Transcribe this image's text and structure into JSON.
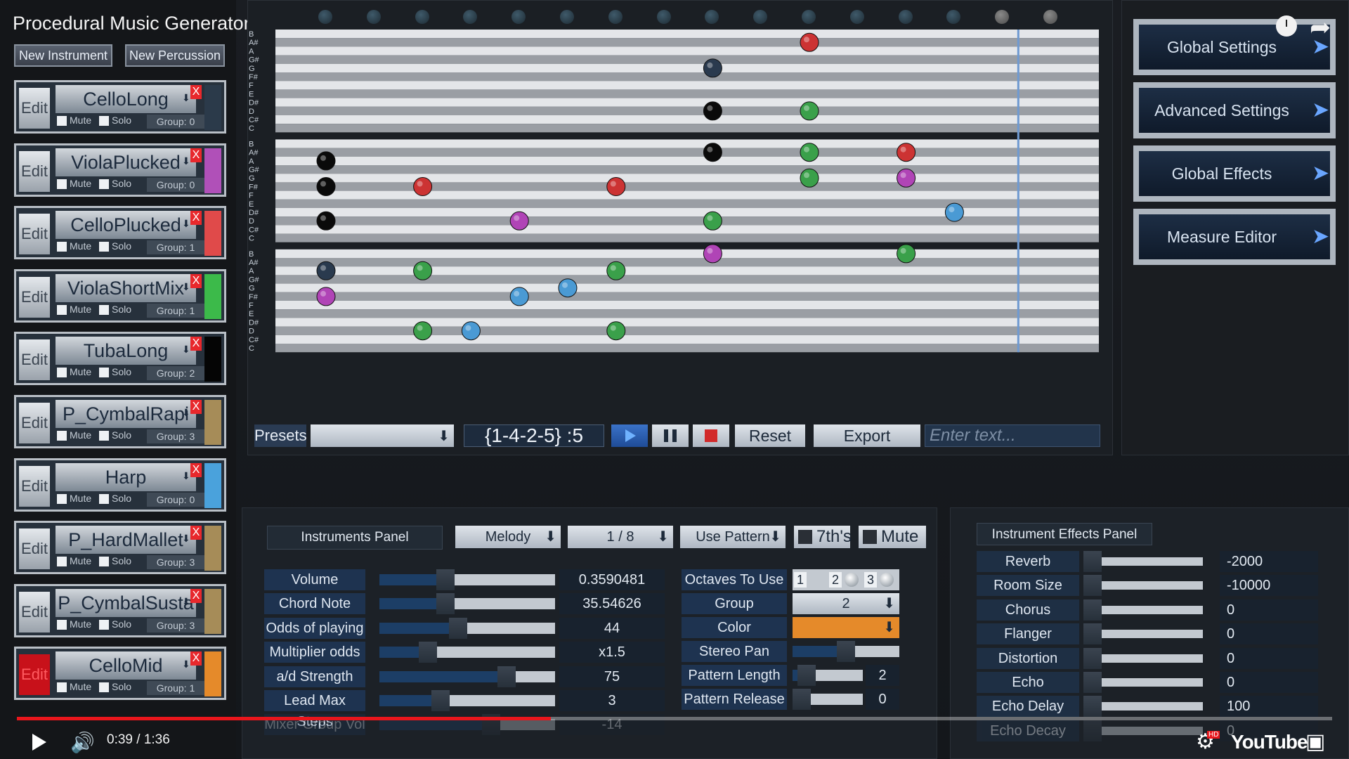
{
  "app": {
    "title": "Procedural Music Generator",
    "new_instrument": "New Instrument",
    "new_percussion": "New Percussion"
  },
  "instrument_rows": [
    {
      "edit": "Edit",
      "name": "CelloLong",
      "mute": "Mute",
      "solo": "Solo",
      "group": "Group: 0",
      "color": "#2b3a4a",
      "active": false
    },
    {
      "edit": "Edit",
      "name": "ViolaPlucked",
      "mute": "Mute",
      "solo": "Solo",
      "group": "Group: 0",
      "color": "#b050b8",
      "active": false
    },
    {
      "edit": "Edit",
      "name": "CelloPlucked",
      "mute": "Mute",
      "solo": "Solo",
      "group": "Group: 1",
      "color": "#e04a4a",
      "active": false
    },
    {
      "edit": "Edit",
      "name": "ViolaShortMix",
      "mute": "Mute",
      "solo": "Solo",
      "group": "Group: 1",
      "color": "#3cba4a",
      "active": false
    },
    {
      "edit": "Edit",
      "name": "TubaLong",
      "mute": "Mute",
      "solo": "Solo",
      "group": "Group: 2",
      "color": "#050505",
      "active": false
    },
    {
      "edit": "Edit",
      "name": "P_CymbalRapi",
      "mute": "Mute",
      "solo": "Solo",
      "group": "Group: 3",
      "color": "#a68c58",
      "active": false
    },
    {
      "edit": "Edit",
      "name": "Harp",
      "mute": "Mute",
      "solo": "Solo",
      "group": "Group: 0",
      "color": "#4aa2dc",
      "active": false
    },
    {
      "edit": "Edit",
      "name": "P_HardMallet",
      "mute": "Mute",
      "solo": "Solo",
      "group": "Group: 3",
      "color": "#a68c58",
      "active": false
    },
    {
      "edit": "Edit",
      "name": "P_CymbalSusta",
      "mute": "Mute",
      "solo": "Solo",
      "group": "Group: 3",
      "color": "#a68c58",
      "active": false
    },
    {
      "edit": "Edit",
      "name": "CelloMid",
      "mute": "Mute",
      "solo": "Solo",
      "group": "Group: 1",
      "color": "#e58a2a",
      "active": true
    }
  ],
  "close_glyph": "X",
  "piano_roll": {
    "note_labels": [
      "B",
      "A#",
      "A",
      "G#",
      "G",
      "F#",
      "F",
      "E",
      "D#",
      "D",
      "C#",
      "C"
    ],
    "beat_count": 16,
    "beats_played": 15,
    "playhead_beat": 14.3,
    "note_colors": {
      "black": "#0a0a0a",
      "navy": "#2a3a4e",
      "red": "#cc3333",
      "green": "#3aa04a",
      "purple": "#b044b6",
      "blue": "#4a9ad4"
    },
    "notes": [
      {
        "octave": 0,
        "pitch": "A#",
        "beat": 10,
        "color": "red"
      },
      {
        "octave": 0,
        "pitch": "G",
        "beat": 8,
        "color": "navy"
      },
      {
        "octave": 0,
        "pitch": "D",
        "beat": 8,
        "color": "black"
      },
      {
        "octave": 0,
        "pitch": "D",
        "beat": 10,
        "color": "green"
      },
      {
        "octave": 1,
        "pitch": "A#",
        "beat": 8,
        "color": "black"
      },
      {
        "octave": 1,
        "pitch": "A#",
        "beat": 10,
        "color": "green"
      },
      {
        "octave": 1,
        "pitch": "A#",
        "beat": 12,
        "color": "red"
      },
      {
        "octave": 1,
        "pitch": "A",
        "beat": 0,
        "color": "black"
      },
      {
        "octave": 1,
        "pitch": "G",
        "beat": 10,
        "color": "green"
      },
      {
        "octave": 1,
        "pitch": "G",
        "beat": 12,
        "color": "purple"
      },
      {
        "octave": 1,
        "pitch": "F#",
        "beat": 0,
        "color": "black"
      },
      {
        "octave": 1,
        "pitch": "F#",
        "beat": 2,
        "color": "red"
      },
      {
        "octave": 1,
        "pitch": "F#",
        "beat": 6,
        "color": "red"
      },
      {
        "octave": 1,
        "pitch": "D#",
        "beat": 13,
        "color": "blue"
      },
      {
        "octave": 1,
        "pitch": "D",
        "beat": 0,
        "color": "black"
      },
      {
        "octave": 1,
        "pitch": "D",
        "beat": 4,
        "color": "purple"
      },
      {
        "octave": 1,
        "pitch": "D",
        "beat": 8,
        "color": "green"
      },
      {
        "octave": 2,
        "pitch": "B",
        "beat": 8,
        "color": "purple"
      },
      {
        "octave": 2,
        "pitch": "B",
        "beat": 12,
        "color": "green"
      },
      {
        "octave": 2,
        "pitch": "A",
        "beat": 0,
        "color": "navy"
      },
      {
        "octave": 2,
        "pitch": "A",
        "beat": 2,
        "color": "green"
      },
      {
        "octave": 2,
        "pitch": "A",
        "beat": 6,
        "color": "green"
      },
      {
        "octave": 2,
        "pitch": "G",
        "beat": 5,
        "color": "blue"
      },
      {
        "octave": 2,
        "pitch": "F#",
        "beat": 0,
        "color": "purple"
      },
      {
        "octave": 2,
        "pitch": "F#",
        "beat": 4,
        "color": "blue"
      },
      {
        "octave": 2,
        "pitch": "D",
        "beat": 2,
        "color": "green"
      },
      {
        "octave": 2,
        "pitch": "D",
        "beat": 3,
        "color": "blue"
      },
      {
        "octave": 2,
        "pitch": "D",
        "beat": 6,
        "color": "green"
      }
    ]
  },
  "toolbar": {
    "presets_label": "Presets",
    "progression": "{1-4-2-5} :5",
    "reset": "Reset",
    "export": "Export",
    "text_placeholder": "Enter text..."
  },
  "nav": [
    {
      "label": "Global Settings"
    },
    {
      "label": "Advanced Settings"
    },
    {
      "label": "Global Effects"
    },
    {
      "label": "Measure Editor"
    }
  ],
  "instruments_panel": {
    "title": "Instruments Panel",
    "mode": "Melody",
    "note_length": "1 / 8",
    "pattern": "Use Pattern",
    "sevenths": "7th's",
    "mute": "Mute",
    "params": [
      {
        "label": "Volume",
        "value": "0.3590481",
        "level": 0.36
      },
      {
        "label": "Chord Note",
        "value": "35.54626",
        "level": 0.36
      },
      {
        "label": "Odds of playing",
        "value": "44",
        "level": 0.44
      },
      {
        "label": "Multiplier odds",
        "value": "x1.5",
        "level": 0.25
      },
      {
        "label": "a/d Strength",
        "value": "75",
        "level": 0.75
      },
      {
        "label": "Lead Max Steps",
        "value": "3",
        "level": 0.33
      },
      {
        "label": "Mixer Group Vol",
        "value": "-14",
        "level": 0.65
      }
    ],
    "octaves_label": "Octaves To Use",
    "octaves": [
      "1",
      "2",
      "3"
    ],
    "group_label": "Group",
    "group_value": "2",
    "color_label": "Color",
    "color_value": "#e58a2a",
    "stereo_label": "Stereo  Pan",
    "stereo_level": 0.5,
    "pattern_length_label": "Pattern Length",
    "pattern_length_value": "2",
    "pattern_length_level": 0.1,
    "pattern_release_label": "Pattern Release",
    "pattern_release_value": "0",
    "pattern_release_level": 0.0
  },
  "effects_panel": {
    "title": "Instrument Effects Panel",
    "effects": [
      {
        "label": "Reverb",
        "value": "-2000"
      },
      {
        "label": "Room Size",
        "value": "-10000"
      },
      {
        "label": "Chorus",
        "value": "0"
      },
      {
        "label": "Flanger",
        "value": "0"
      },
      {
        "label": "Distortion",
        "value": "0"
      },
      {
        "label": "Echo",
        "value": "0"
      },
      {
        "label": "Echo Delay",
        "value": "100"
      },
      {
        "label": "Echo Decay",
        "value": "0"
      }
    ]
  },
  "video": {
    "time": "0:39 / 1:36",
    "progress": 0.406,
    "hd": "HD",
    "brand": "YouTube"
  }
}
